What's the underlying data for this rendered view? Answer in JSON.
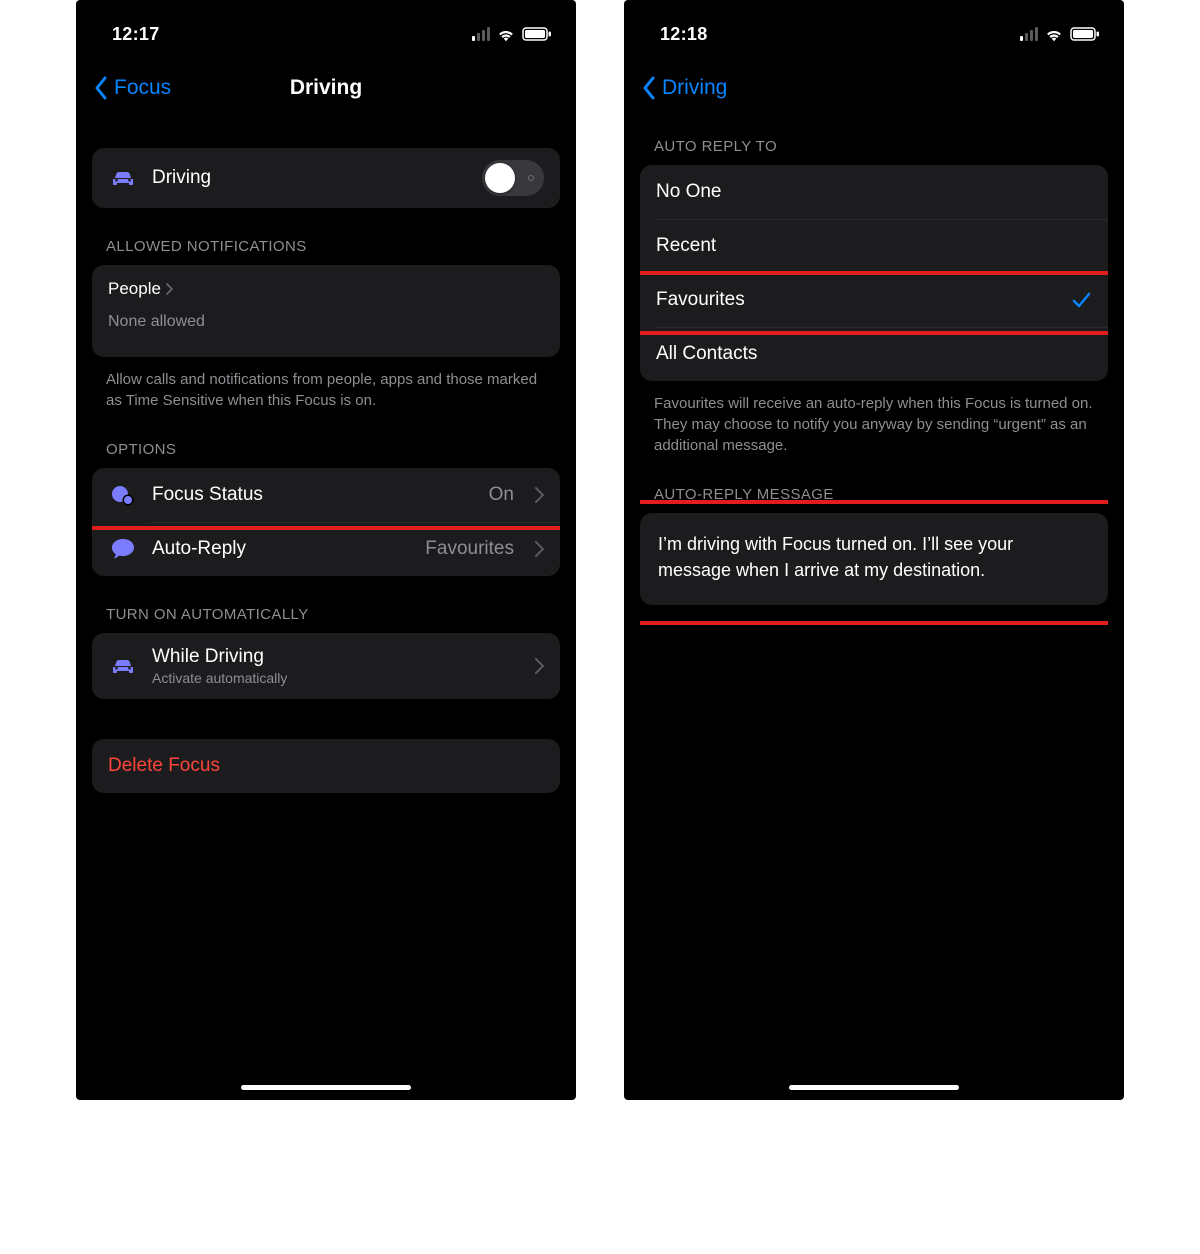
{
  "left": {
    "status": {
      "time": "12:17"
    },
    "nav": {
      "back": "Focus",
      "title": "Driving"
    },
    "toggle_row": {
      "label": "Driving"
    },
    "allowed": {
      "header": "ALLOWED NOTIFICATIONS",
      "people_label": "People",
      "people_value": "None allowed",
      "footer": "Allow calls and notifications from people, apps and those marked as Time Sensitive when this Focus is on."
    },
    "options": {
      "header": "OPTIONS",
      "focus_status_label": "Focus Status",
      "focus_status_value": "On",
      "auto_reply_label": "Auto-Reply",
      "auto_reply_value": "Favourites"
    },
    "auto": {
      "header": "TURN ON AUTOMATICALLY",
      "while_driving_label": "While Driving",
      "while_driving_sub": "Activate automatically"
    },
    "delete_label": "Delete Focus"
  },
  "right": {
    "status": {
      "time": "12:18"
    },
    "nav": {
      "back": "Driving"
    },
    "auto_reply_to": {
      "header": "AUTO REPLY TO",
      "items": [
        "No One",
        "Recent",
        "Favourites",
        "All Contacts"
      ],
      "selected_index": 2,
      "footer": "Favourites will receive an auto-reply when this Focus is turned on. They may choose to notify you anyway by sending “urgent” as an additional message."
    },
    "message": {
      "header": "AUTO-REPLY MESSAGE",
      "text": "I’m driving with Focus turned on. I’ll see your message when I arrive at my destination."
    }
  },
  "colors": {
    "accent_blue": "#0a84ff",
    "icon_purple": "#7c7cff",
    "destructive_red": "#ff453a",
    "highlight_red": "#e11d1d"
  }
}
